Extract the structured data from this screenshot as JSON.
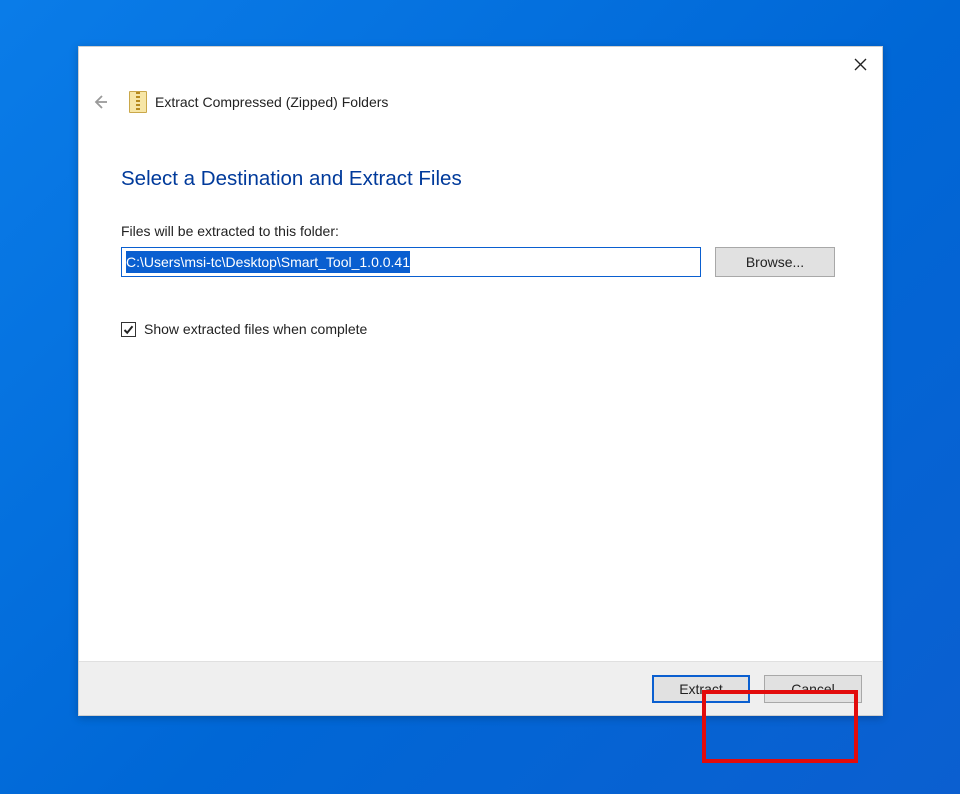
{
  "wizard": {
    "title": "Extract Compressed (Zipped) Folders"
  },
  "page": {
    "title": "Select a Destination and Extract Files",
    "field_label": "Files will be extracted to this folder:",
    "path_value": "C:\\Users\\msi-tc\\Desktop\\Smart_Tool_1.0.0.41",
    "browse_label": "Browse...",
    "checkbox_label": "Show extracted files when complete",
    "checkbox_checked": true
  },
  "buttons": {
    "extract": "Extract",
    "cancel": "Cancel"
  }
}
